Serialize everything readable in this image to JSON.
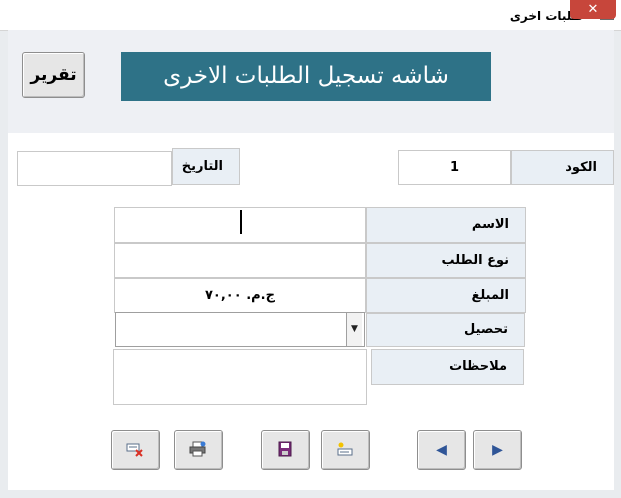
{
  "window": {
    "title": "طلبات اخرى",
    "close_label": "✕"
  },
  "header": {
    "report_button": "تقرير",
    "banner_title": "شاشه تسجيل الطلبات الاخرى"
  },
  "fields": {
    "code": {
      "label": "الكود",
      "value": "1"
    },
    "date": {
      "label": "التاريخ",
      "value": ""
    },
    "name": {
      "label": "الاسم",
      "value": ""
    },
    "request_type": {
      "label": "نوع الطلب",
      "value": ""
    },
    "amount": {
      "label": "المبلغ",
      "value": "ج.م. ٧٠,٠٠"
    },
    "collection": {
      "label": "تحصيل",
      "value": ""
    },
    "notes": {
      "label": "ملاحظات",
      "value": ""
    }
  },
  "toolbar": [
    {
      "name": "delete-record-button",
      "icon": "delete-record-icon"
    },
    {
      "name": "print-button",
      "icon": "printer-icon"
    },
    {
      "name": "save-button",
      "icon": "floppy-disk-icon"
    },
    {
      "name": "new-record-button",
      "icon": "new-record-icon"
    },
    {
      "name": "previous-record-button",
      "icon": "arrow-left-icon"
    },
    {
      "name": "next-record-button",
      "icon": "arrow-right-icon"
    }
  ],
  "colors": {
    "banner": "#2e7287",
    "label_bg": "#e9eff5",
    "nav_arrow": "#2f5597",
    "close": "#c7463b"
  }
}
